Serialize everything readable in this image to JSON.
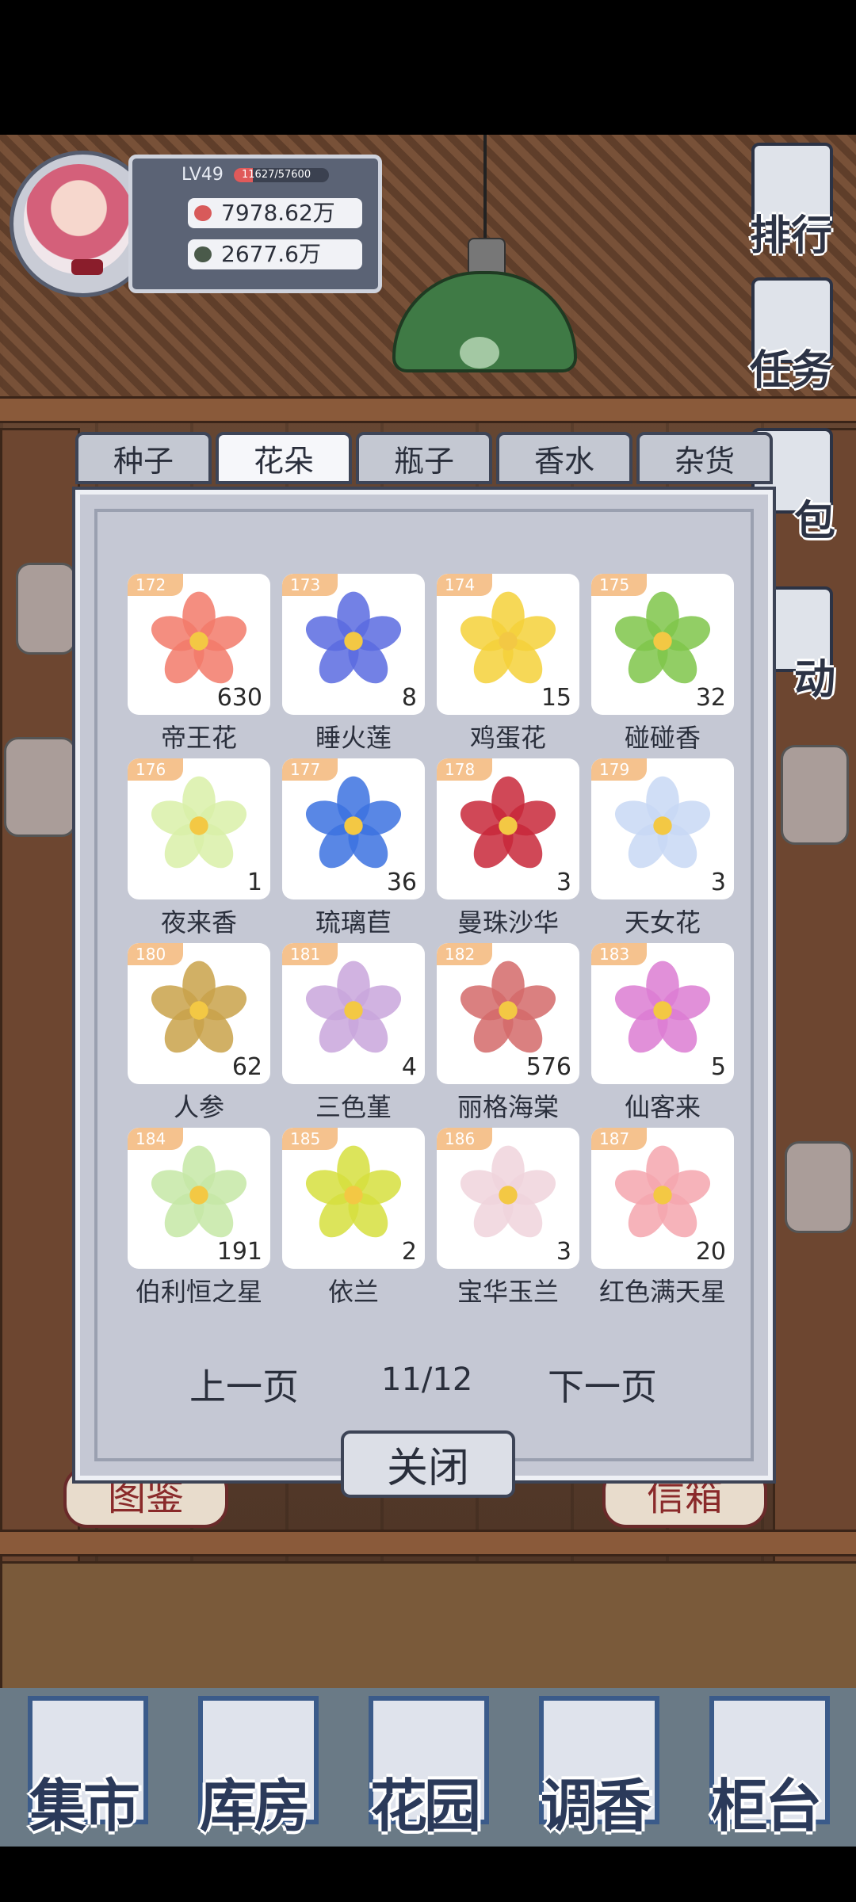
{
  "player": {
    "level": "LV49",
    "xp_text": "11627/57600",
    "xp_fraction": 0.2,
    "money": "7978.62万",
    "leaf": "2677.6万"
  },
  "side_buttons": [
    "排行",
    "任务",
    "包",
    "动"
  ],
  "tabs": [
    {
      "label": "种子",
      "active": false
    },
    {
      "label": "花朵",
      "active": true
    },
    {
      "label": "瓶子",
      "active": false
    },
    {
      "label": "香水",
      "active": false
    },
    {
      "label": "杂货",
      "active": false
    }
  ],
  "flowers": [
    {
      "id": "172",
      "name": "帝王花",
      "qty": "630",
      "color": "#f27a6a"
    },
    {
      "id": "173",
      "name": "睡火莲",
      "qty": "8",
      "color": "#5a6be0"
    },
    {
      "id": "174",
      "name": "鸡蛋花",
      "qty": "15",
      "color": "#f5d13a"
    },
    {
      "id": "175",
      "name": "碰碰香",
      "qty": "32",
      "color": "#7fc64a"
    },
    {
      "id": "176",
      "name": "夜来香",
      "qty": "1",
      "color": "#d9f0a8"
    },
    {
      "id": "177",
      "name": "琉璃苣",
      "qty": "36",
      "color": "#3c72e0"
    },
    {
      "id": "178",
      "name": "曼珠沙华",
      "qty": "3",
      "color": "#c8283a"
    },
    {
      "id": "179",
      "name": "天女花",
      "qty": "3",
      "color": "#c8d8f4"
    },
    {
      "id": "180",
      "name": "人参",
      "qty": "62",
      "color": "#c9a24a"
    },
    {
      "id": "181",
      "name": "三色堇",
      "qty": "4",
      "color": "#c9a6dc"
    },
    {
      "id": "182",
      "name": "丽格海棠",
      "qty": "576",
      "color": "#d46a6a"
    },
    {
      "id": "183",
      "name": "仙客来",
      "qty": "5",
      "color": "#dc7cd2"
    },
    {
      "id": "184",
      "name": "伯利恒之星",
      "qty": "191",
      "color": "#c6e8a6"
    },
    {
      "id": "185",
      "name": "依兰",
      "qty": "2",
      "color": "#d6df3e"
    },
    {
      "id": "186",
      "name": "宝华玉兰",
      "qty": "3",
      "color": "#f0d4dc"
    },
    {
      "id": "187",
      "name": "红色满天星",
      "qty": "20",
      "color": "#f4a6ae"
    }
  ],
  "pager": {
    "prev": "上一页",
    "page": "11/12",
    "next": "下一页"
  },
  "close": "关闭",
  "hidden_behind": {
    "left": "图鉴",
    "right": "信箱"
  },
  "bottom_nav": [
    "集市",
    "库房",
    "花园",
    "调香",
    "柜台"
  ]
}
